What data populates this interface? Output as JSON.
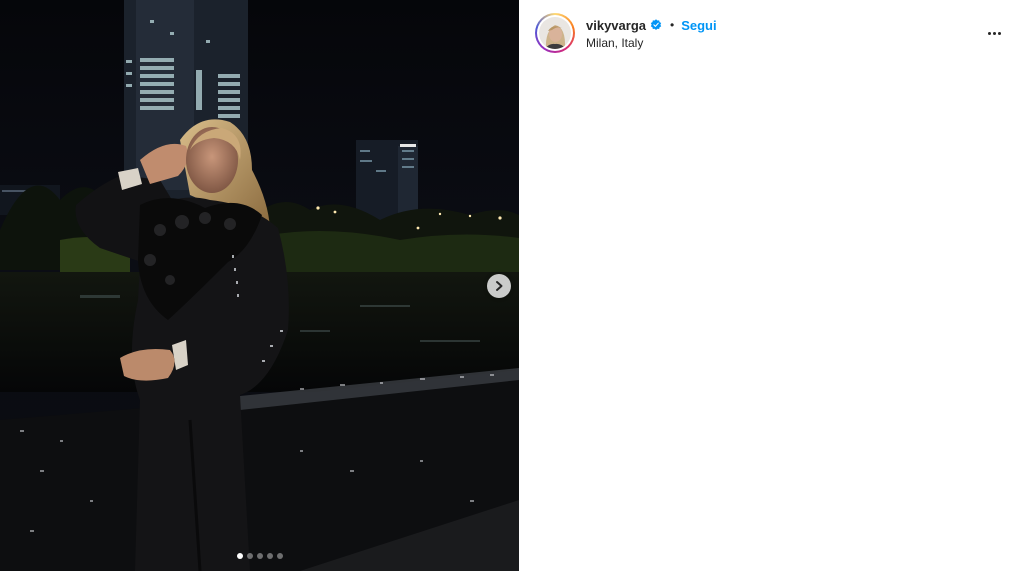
{
  "post": {
    "username": "vikyvarga",
    "verified": true,
    "separator": "•",
    "follow_label": "Segui",
    "location": "Milan, Italy",
    "more_icon": "more-options-icon"
  },
  "carousel": {
    "slide_count": 5,
    "active_slide": 1,
    "next_icon": "chevron-right-icon"
  },
  "colors": {
    "accent": "#0095f6",
    "text": "#262626",
    "verified_badge": "#0095f6"
  }
}
